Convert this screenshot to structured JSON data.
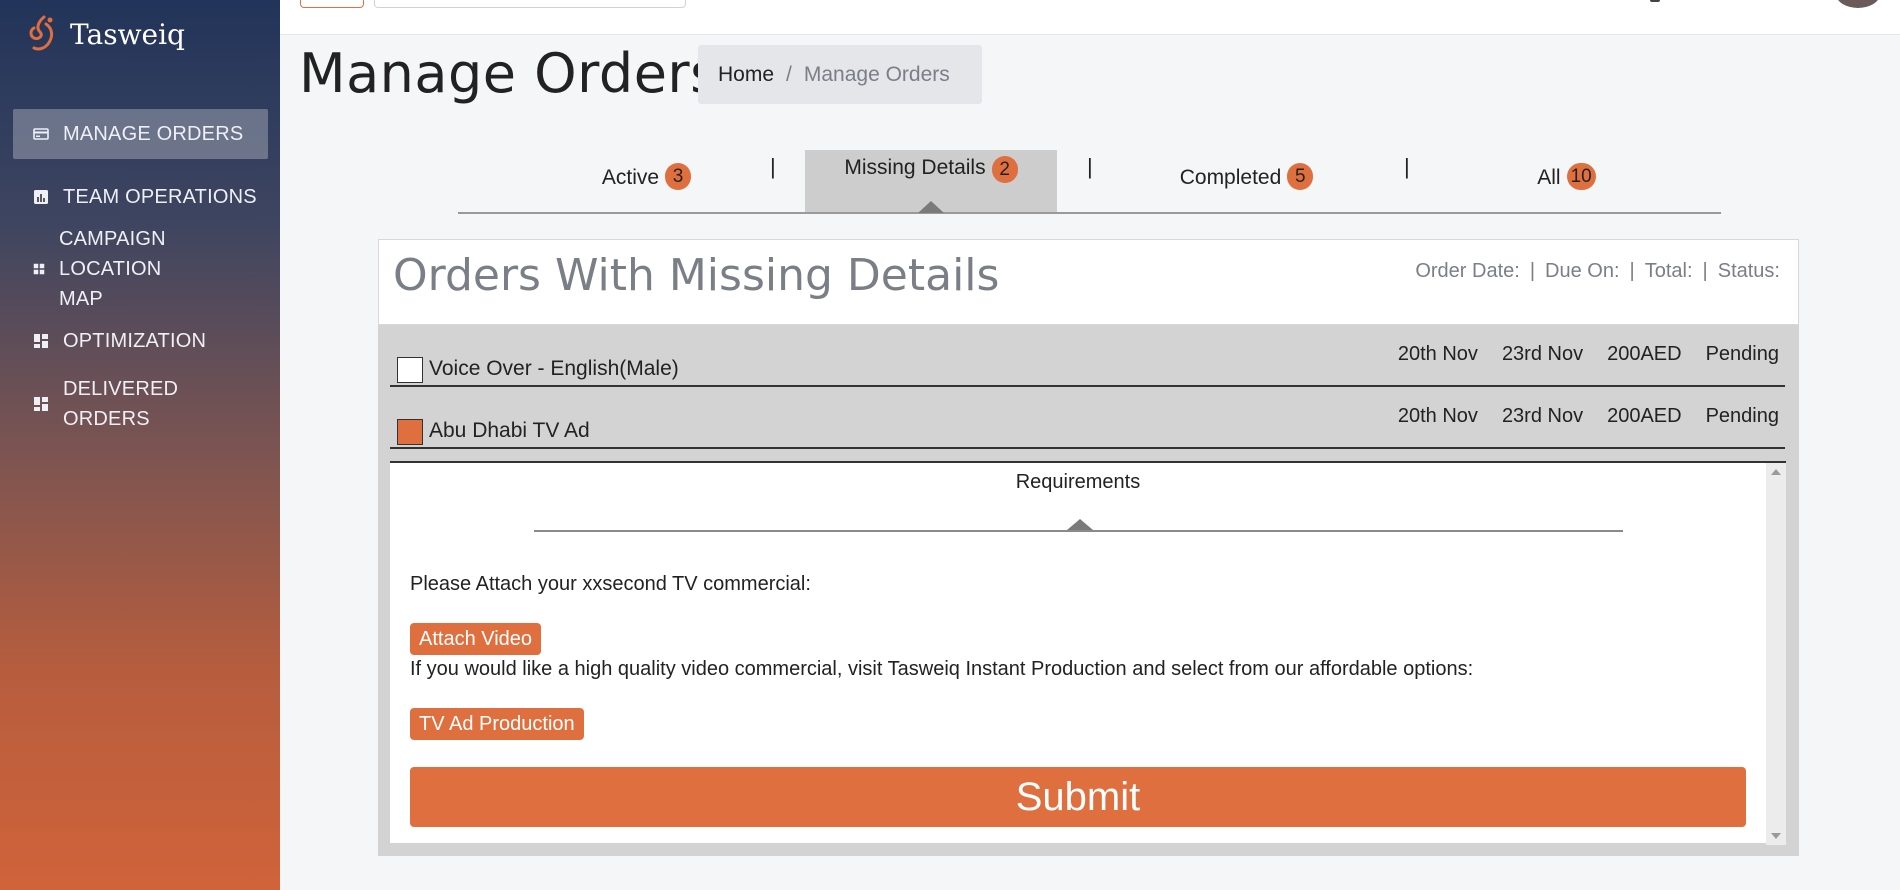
{
  "brand": {
    "name": "Tasweiq"
  },
  "sidebar": {
    "items": [
      {
        "label": "MANAGE ORDERS",
        "icon": "card-icon"
      },
      {
        "label": "TEAM OPERATIONS",
        "icon": "bar-chart-icon"
      },
      {
        "label": "CAMPAIGN LOCATION MAP",
        "icon": "grid-icon"
      },
      {
        "label": "OPTIMIZATION",
        "icon": "dashboard-icon"
      },
      {
        "label": "DELIVERED ORDERS",
        "icon": "dashboard-icon"
      }
    ]
  },
  "header": {
    "title": "Manage Orders",
    "breadcrumb": {
      "home": "Home",
      "separator": "/",
      "current": "Manage Orders"
    }
  },
  "tabs": [
    {
      "label": "Active",
      "count": "3"
    },
    {
      "label": "Missing Details",
      "count": "2",
      "selected": true
    },
    {
      "label": "Completed",
      "count": "5"
    },
    {
      "label": "All",
      "count": "10"
    }
  ],
  "tab_separator": "|",
  "panel": {
    "title": "Orders With Missing Details",
    "columns": [
      "Order Date:",
      "Due On:",
      "Total:",
      "Status:"
    ],
    "column_separator": "|",
    "orders": [
      {
        "name": "Voice Over - English(Male)",
        "order_date": "20th Nov",
        "due_on": "23rd Nov",
        "total": "200AED",
        "status": "Pending",
        "checked": false
      },
      {
        "name": "Abu Dhabi TV Ad",
        "order_date": "20th Nov",
        "due_on": "23rd Nov",
        "total": "200AED",
        "status": "Pending",
        "checked": true
      }
    ]
  },
  "requirements": {
    "tab_label": "Requirements",
    "attach_prompt": "Please Attach your xxsecond TV commercial:",
    "attach_button": "Attach Video",
    "production_prompt": "If you would like a high quality video commercial, visit Tasweiq Instant Production and select from our affordable options:",
    "production_button": "TV Ad Production",
    "submit_button": "Submit"
  },
  "colors": {
    "accent": "#e06f3f",
    "sidebar_top": "#22345a",
    "sidebar_bottom": "#d0633a",
    "tab_selected_bg": "#cdcdcd"
  }
}
